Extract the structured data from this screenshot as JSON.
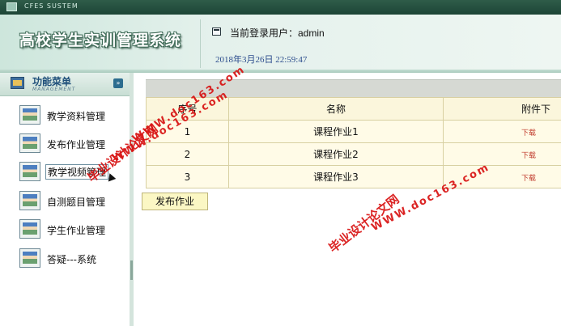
{
  "topbar": {
    "system_name": "CFES SUSTEM"
  },
  "header": {
    "app_title": "高校学生实训管理系统",
    "user_line": "当前登录用户：admin",
    "datetime": "2018年3月26日  22:59:47"
  },
  "sidebar": {
    "title": "功能菜单",
    "subtitle": "MANAGEMENT",
    "collapse_glyph": "»",
    "items": [
      {
        "label": "教学资料管理",
        "icon": "student-card-icon"
      },
      {
        "label": "发布作业管理",
        "icon": "student-card-icon"
      },
      {
        "label": "教学视频管理",
        "icon": "student-card-icon"
      },
      {
        "label": "自测题目管理",
        "icon": "student-card-icon"
      },
      {
        "label": "学生作业管理",
        "icon": "student-card-icon"
      },
      {
        "label": "答疑---系统",
        "icon": "student-card-icon"
      }
    ]
  },
  "table": {
    "headers": [
      "序号",
      "名称",
      "附件下"
    ],
    "rows": [
      {
        "no": "1",
        "name": "课程作业1",
        "action": "下载"
      },
      {
        "no": "2",
        "name": "课程作业2",
        "action": "下载"
      },
      {
        "no": "3",
        "name": "课程作业3",
        "action": "下载"
      }
    ]
  },
  "publish_button": "发布作业",
  "watermarks": [
    {
      "text": "毕业设计论文网"
    },
    {
      "text": "WWW.doc163.com"
    }
  ],
  "colors": {
    "accent_green": "#1d4536",
    "link_red": "#c0392b",
    "watermark_red": "#d81212"
  }
}
